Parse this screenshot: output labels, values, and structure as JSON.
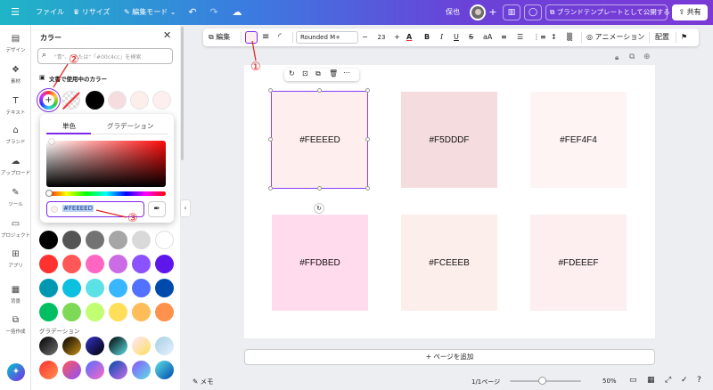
{
  "topbar": {
    "file": "ファイル",
    "resize": "♛ リサイズ",
    "edit_mode": "編集モード",
    "share_status": "保也",
    "publish_template": "ブランドテンプレートとして公開する",
    "share": "共有"
  },
  "rail": [
    {
      "icon": "layout-icon",
      "label": "デザイン"
    },
    {
      "icon": "elements-icon",
      "label": "素材"
    },
    {
      "icon": "text-icon",
      "label": "テキスト"
    },
    {
      "icon": "brand-icon",
      "label": "ブランド"
    },
    {
      "icon": "upload-icon",
      "label": "アップロード"
    },
    {
      "icon": "draw-icon",
      "label": "ツール"
    },
    {
      "icon": "folder-icon",
      "label": "プロジェクト"
    },
    {
      "icon": "apps-icon",
      "label": "アプリ"
    },
    {
      "icon": "background-icon",
      "label": "背景"
    },
    {
      "icon": "bulk-create-icon",
      "label": "一括作成"
    }
  ],
  "panel": {
    "title": "カラー",
    "search_placeholder": "\"青\"、\"または\"「#00c4cc」を検索",
    "doc_colors_title": "文書で使用中のカラー",
    "doc_colors": [
      "#000000",
      "#F5DDDF",
      "#FCEEEB",
      "#FDEEEF"
    ],
    "default_colors": [
      "#000000",
      "#545454",
      "#737373",
      "#a6a6a6",
      "#d9d9d9",
      "#ffffff",
      "#ff3131",
      "#ff5757",
      "#ff66c4",
      "#cb6ce6",
      "#8c52ff",
      "#5e17eb",
      "#0097b2",
      "#0cc0df",
      "#5ce1e6",
      "#38b6ff",
      "#5271ff",
      "#004aad",
      "#00bf63",
      "#7ed957",
      "#c1ff72",
      "#ffde59",
      "#ffbd59",
      "#ff914d"
    ],
    "gradient_title": "グラデーション",
    "gradients": [
      [
        "#000000",
        "#737373"
      ],
      [
        "#000000",
        "#c89116"
      ],
      [
        "#3533cd",
        "#000000"
      ],
      [
        "#000000",
        "#5de0e6"
      ],
      [
        "#fee7ff",
        "#ffde59"
      ],
      [
        "#a6cee3",
        "#e6f3ff"
      ],
      [
        "#ff3131",
        "#ff914d"
      ],
      [
        "#ff5757",
        "#8c52ff"
      ],
      [
        "#5170ff",
        "#ff66c4"
      ],
      [
        "#004aad",
        "#cb6ce6"
      ],
      [
        "#8c52ff",
        "#5ce1e6"
      ],
      [
        "#5de0e6",
        "#004aad"
      ]
    ]
  },
  "picker": {
    "tab_solid": "単色",
    "tab_gradient": "グラデーション",
    "hex_value": "#FEEEED"
  },
  "toolbar": {
    "edit": "編集",
    "font": "Rounded M+",
    "font_size": "23",
    "animation": "アニメーション",
    "arrange": "配置"
  },
  "cards": [
    {
      "color": "#FEEEED",
      "label": "#FEEEED"
    },
    {
      "color": "#F5DDDF",
      "label": "#F5DDDF"
    },
    {
      "color": "#FEF4F4",
      "label": "#FEF4F4"
    },
    {
      "color": "#FFDBED",
      "label": "#FFDBED"
    },
    {
      "color": "#FCEEEB",
      "label": "#FCEEEB"
    },
    {
      "color": "#FDEEEF",
      "label": "#FDEEEF"
    }
  ],
  "annotations": [
    "①",
    "②",
    "③"
  ],
  "add_page": "+ ページを追加",
  "bottom": {
    "notes": "メモ",
    "page_indicator": "1/1ページ",
    "zoom": "50%"
  }
}
